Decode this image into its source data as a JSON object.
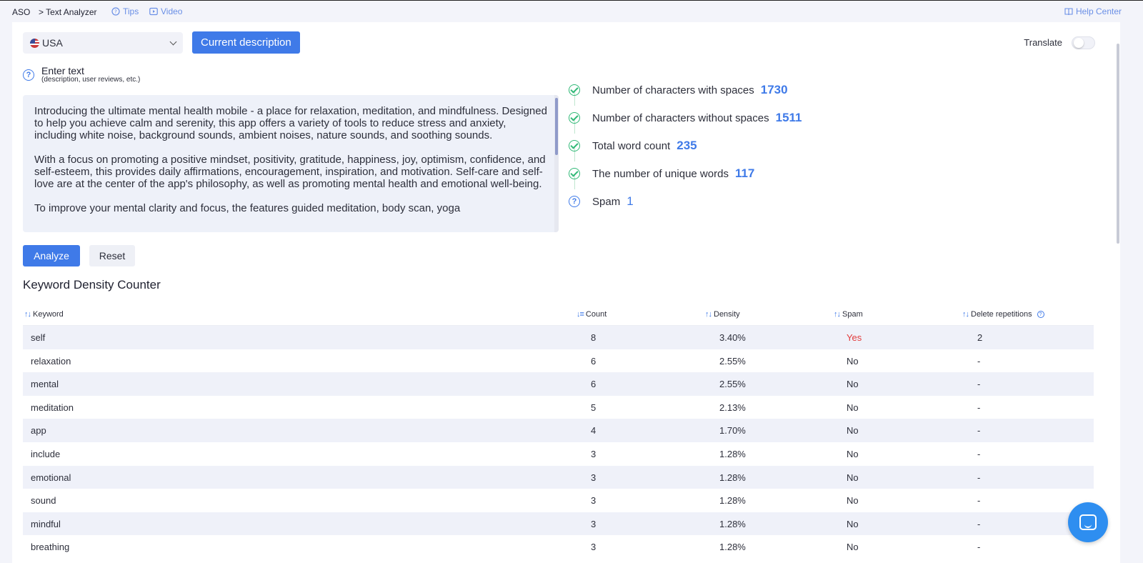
{
  "breadcrumb": {
    "root": "ASO",
    "page": "> Text Analyzer"
  },
  "top_links": {
    "tips": "Tips",
    "video": "Video",
    "help": "Help Center"
  },
  "controls": {
    "country": "USA",
    "current_description": "Current description",
    "translate": "Translate"
  },
  "enter_text": {
    "title": "Enter text",
    "subtitle": "(description, user reviews, etc.)",
    "paragraphs": [
      "Introducing the ultimate mental health mobile - a place for relaxation, meditation, and mindfulness. Designed to help you achieve calm and serenity, this app offers a variety of tools to reduce stress and anxiety, including white noise, background sounds, ambient noises, nature sounds, and soothing sounds.",
      "With a focus on promoting a positive mindset, positivity, gratitude, happiness, joy, optimism, confidence, and self-esteem, this provides daily affirmations, encouragement, inspiration, and motivation. Self-care and self-love are at the center of the app's philosophy, as well as promoting mental health and emotional well-being.",
      "To improve your mental clarity and focus, the features guided meditation, body scan, yoga"
    ]
  },
  "stats": [
    {
      "label": "Number of characters with spaces",
      "value": "1730",
      "status": "check"
    },
    {
      "label": "Number of characters without spaces",
      "value": "1511",
      "status": "check"
    },
    {
      "label": "Total word count",
      "value": "235",
      "status": "check"
    },
    {
      "label": "The number of unique words",
      "value": "117",
      "status": "check"
    },
    {
      "label": "Spam",
      "value": "1",
      "status": "question"
    }
  ],
  "buttons": {
    "analyze": "Analyze",
    "reset": "Reset"
  },
  "keyword_section": {
    "title": "Keyword Density Counter",
    "columns": [
      "Keyword",
      "Count",
      "Density",
      "Spam",
      "Delete repetitions"
    ],
    "rows": [
      {
        "keyword": "self",
        "count": "8",
        "density": "3.40%",
        "spam": "Yes",
        "delete": "2"
      },
      {
        "keyword": "relaxation",
        "count": "6",
        "density": "2.55%",
        "spam": "No",
        "delete": "-"
      },
      {
        "keyword": "mental",
        "count": "6",
        "density": "2.55%",
        "spam": "No",
        "delete": "-"
      },
      {
        "keyword": "meditation",
        "count": "5",
        "density": "2.13%",
        "spam": "No",
        "delete": "-"
      },
      {
        "keyword": "app",
        "count": "4",
        "density": "1.70%",
        "spam": "No",
        "delete": "-"
      },
      {
        "keyword": "include",
        "count": "3",
        "density": "1.28%",
        "spam": "No",
        "delete": "-"
      },
      {
        "keyword": "emotional",
        "count": "3",
        "density": "1.28%",
        "spam": "No",
        "delete": "-"
      },
      {
        "keyword": "sound",
        "count": "3",
        "density": "1.28%",
        "spam": "No",
        "delete": "-"
      },
      {
        "keyword": "mindful",
        "count": "3",
        "density": "1.28%",
        "spam": "No",
        "delete": "-"
      },
      {
        "keyword": "breathing",
        "count": "3",
        "density": "1.28%",
        "spam": "No",
        "delete": "-"
      }
    ]
  },
  "colors": {
    "accent": "#3f7ae8",
    "success": "#31b977",
    "danger": "#e23c3c",
    "chat": "#2e8ef0"
  },
  "icons": {
    "tips": "question-circle-icon",
    "video": "play-icon",
    "help": "book-icon",
    "chat": "chat-icon"
  }
}
